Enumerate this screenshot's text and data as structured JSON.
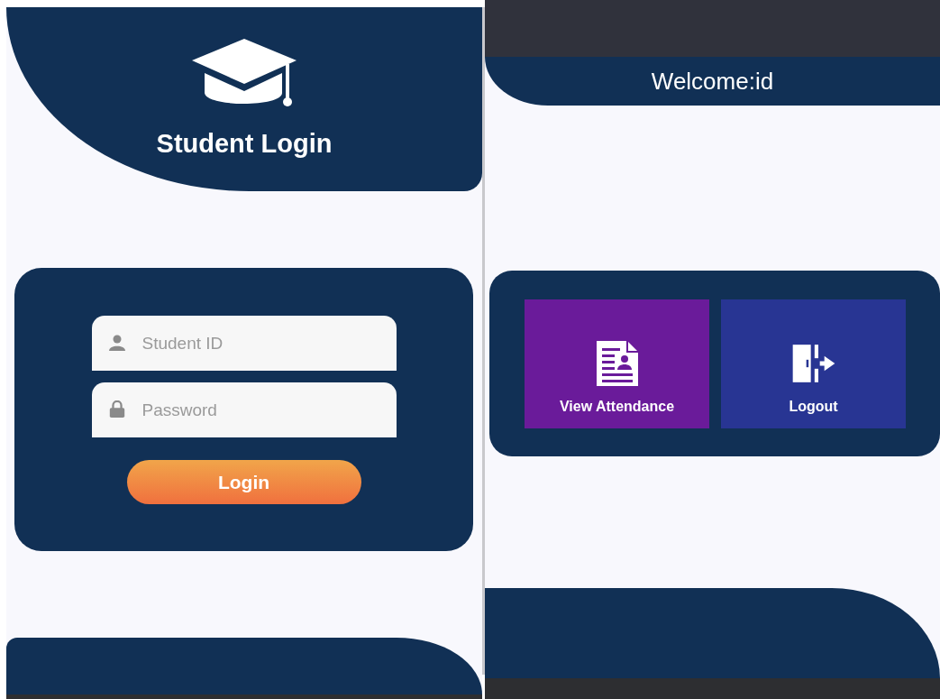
{
  "login_screen": {
    "title": "Student Login",
    "fields": [
      {
        "kind": "user",
        "placeholder": "Student ID"
      },
      {
        "kind": "lock",
        "placeholder": "Password"
      }
    ],
    "button": "Login"
  },
  "home_screen": {
    "title": "Welcome:id",
    "tiles": [
      {
        "kind": "attendance",
        "label": "View Attendance",
        "color": "#6a1b9a"
      },
      {
        "kind": "logout",
        "label": "Logout",
        "color": "#283593"
      }
    ]
  }
}
